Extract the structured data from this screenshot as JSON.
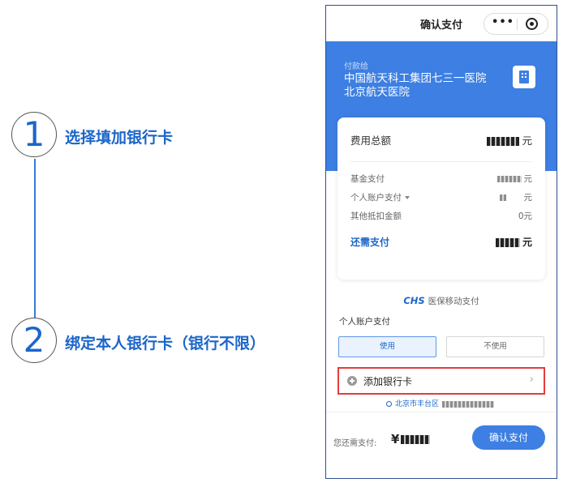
{
  "guide": {
    "step1": {
      "number": "1",
      "text": "选择填加银行卡"
    },
    "step2": {
      "number": "2",
      "text": "绑定本人银行卡（银行不限）"
    }
  },
  "header": {
    "title": "确认支付",
    "more_label": "•••"
  },
  "payee": {
    "label": "付款给",
    "name_line1": "中国航天科工集团七三一医院",
    "name_line2": "北京航天医院"
  },
  "summary": {
    "total_label": "费用总额",
    "total_unit": "元",
    "fund_label": "基金支付",
    "fund_unit": "元",
    "personal_label": "个人账户支付",
    "personal_unit": "元",
    "other_label": "其他抵扣金额",
    "other_value": "0元",
    "due_label": "还需支付",
    "due_unit": "元"
  },
  "chs": {
    "logo": "CHS",
    "text": "医保移动支付"
  },
  "account": {
    "label": "个人账户支付",
    "use_label": "使用",
    "no_use_label": "不使用"
  },
  "add_card": {
    "label": "添加银行卡",
    "chevron": "›"
  },
  "location": {
    "text": "北京市丰台区"
  },
  "footer": {
    "pay_label": "您还需支付:",
    "currency": "¥",
    "confirm_label": "确认支付"
  },
  "colors": {
    "brand_blue": "#3d7fe2",
    "accent_text": "#1b66c9",
    "highlight_red": "#e33c3c"
  }
}
